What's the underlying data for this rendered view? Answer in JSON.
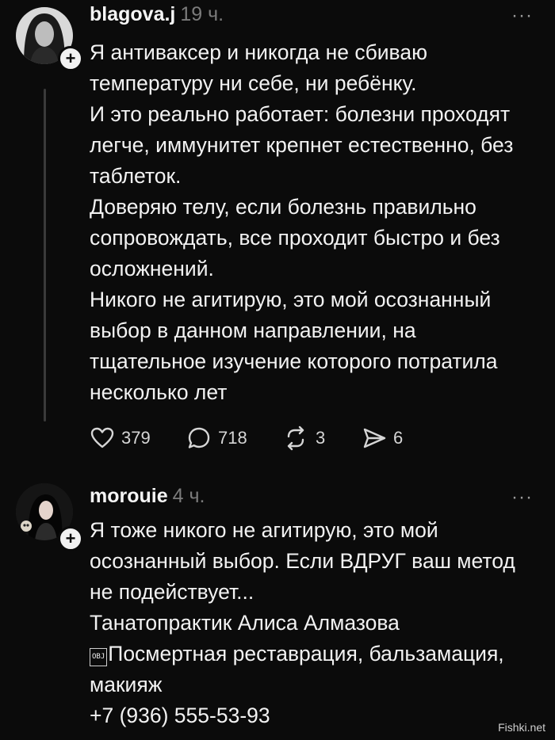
{
  "posts": [
    {
      "username": "blagova.j",
      "time": "19 ч.",
      "more": "···",
      "lines": [
        "Я антиваксер и никогда не сбиваю",
        "температуру  ни себе, ни ребёнку.",
        "И это реально работает: болезни проходят",
        "легче, иммунитет крепнет естественно, без",
        "таблеток.",
        "Доверяю телу, если болезнь правильно",
        "сопровождать, все проходит быстро и без",
        "осложнений.",
        "Никого не агитирую, это мой осознанный",
        "выбор в данном направлении, на",
        "тщательное изучение которого потратила",
        "несколько лет"
      ],
      "actions": {
        "likes": "379",
        "comments": "718",
        "reposts": "3",
        "shares": "6"
      }
    },
    {
      "username": "morouie",
      "time": "4 ч.",
      "more": "···",
      "lines": [
        "Я тоже никого не агитирую, это мой",
        "осознанный выбор. Если ВДРУГ ваш метод",
        "не подействует...",
        "Танатопрактик Алиса Алмазова",
        "Посмертная реставрация, бальзамация,",
        "макияж",
        "+7 (936) 555-53-93"
      ],
      "obj_glyph": "OBJ"
    }
  ],
  "watermark": "Fishki.net",
  "icons": {
    "like": "heart-icon",
    "comment": "comment-bubble-icon",
    "repost": "repost-icon",
    "share": "send-icon",
    "follow": "plus-icon",
    "more": "more-options-icon"
  }
}
